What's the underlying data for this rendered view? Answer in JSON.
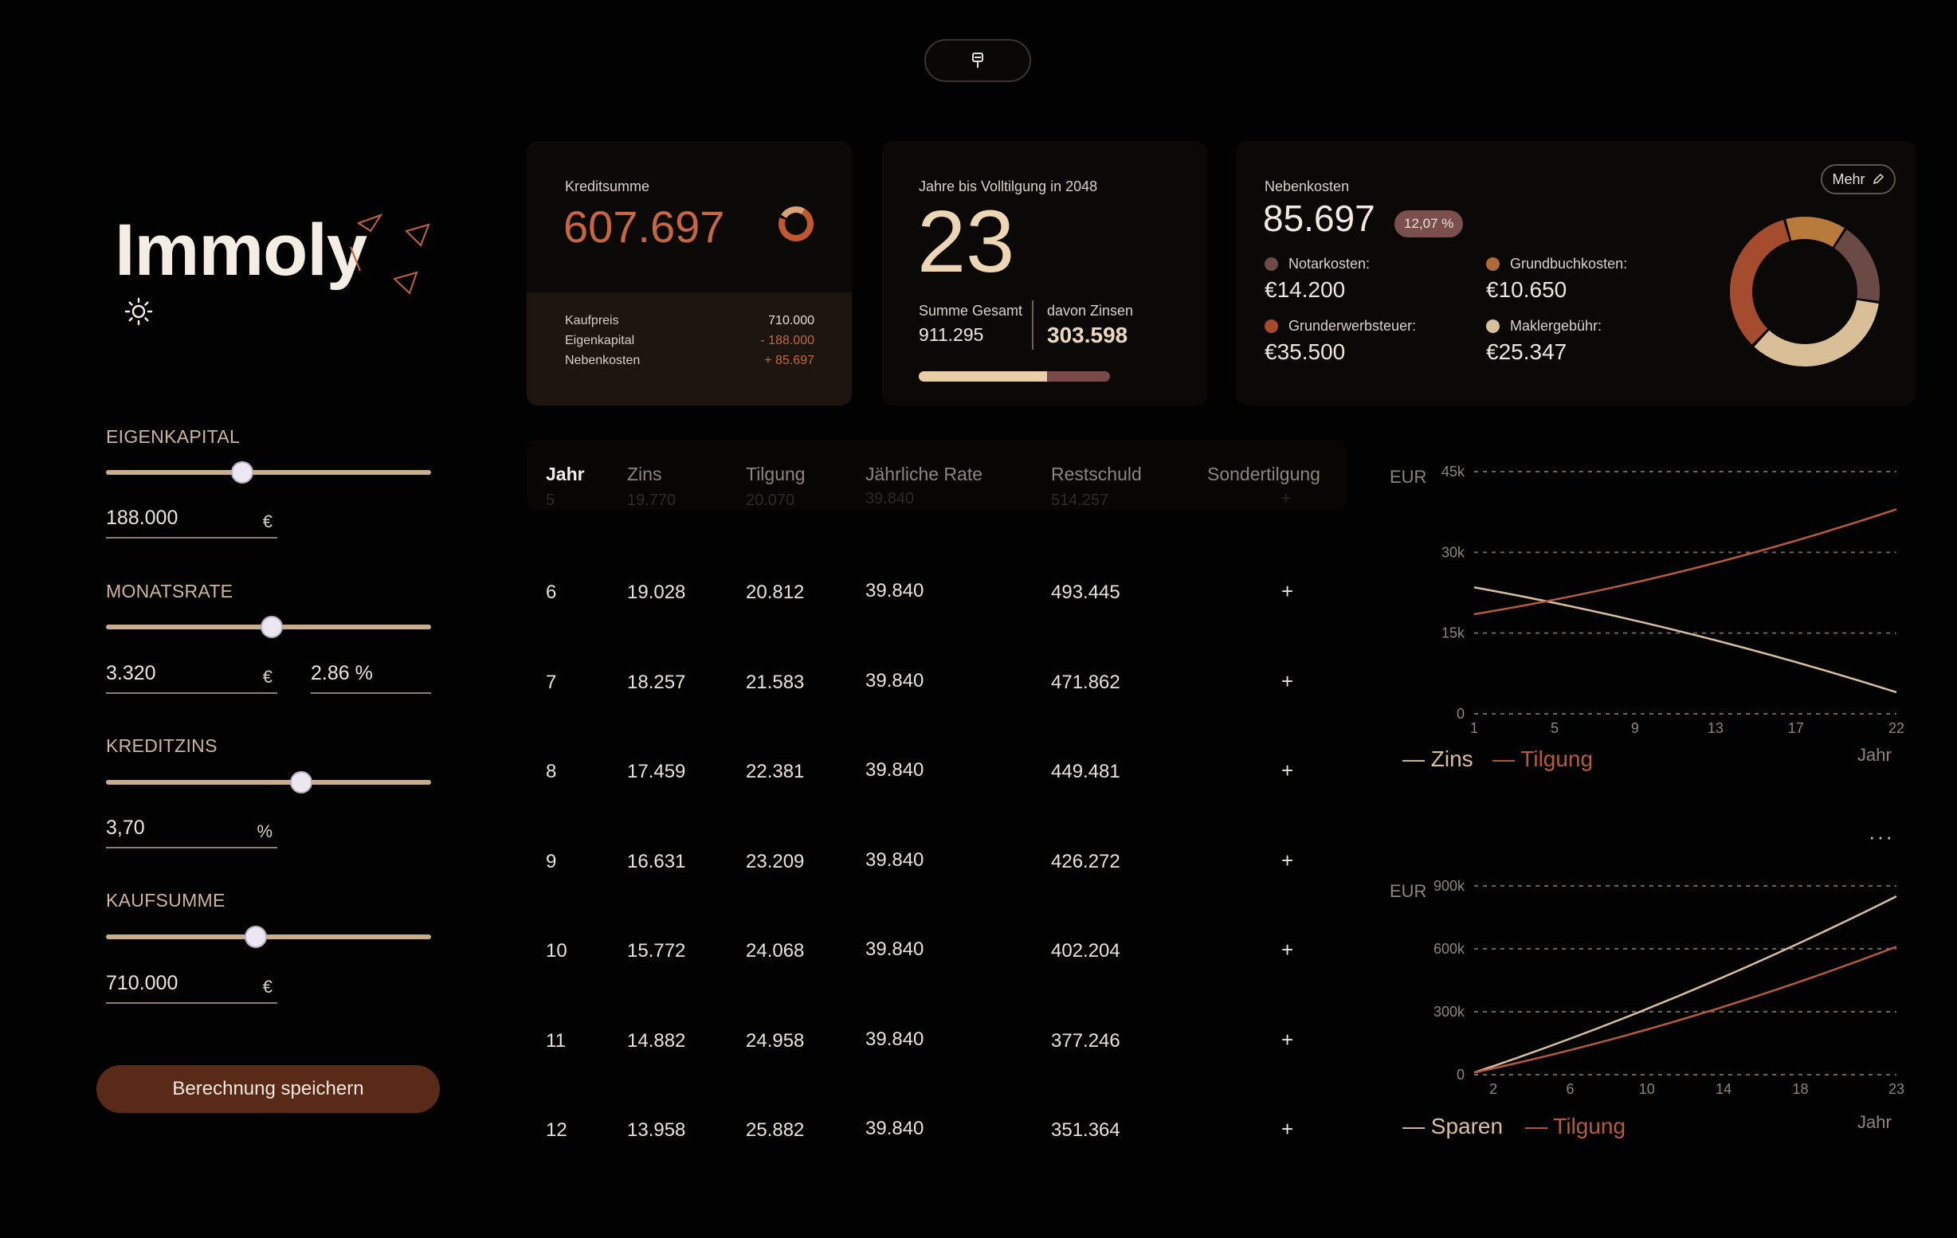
{
  "app": {
    "logo": "Immoly"
  },
  "sidebar": {
    "params": [
      {
        "label": "EIGENKAPITAL",
        "value": "188.000",
        "unit": "€",
        "slider_fraction": 0.42
      },
      {
        "label": "MONATSRATE",
        "value": "3.320",
        "unit": "€",
        "extra_value": "2.86 %",
        "slider_fraction": 0.51
      },
      {
        "label": "KREDITZINS",
        "value": "3,70",
        "unit": "%",
        "slider_fraction": 0.6
      },
      {
        "label": "KAUFSUMME",
        "value": "710.000",
        "unit": "€",
        "slider_fraction": 0.46
      }
    ],
    "save_label": "Berechnung speichern"
  },
  "credit_card": {
    "label": "Kreditsumme",
    "value": "607.697",
    "rows": [
      {
        "label": "Kaufpreis",
        "value": "710.000"
      },
      {
        "label": "Eigenkapital",
        "value": "- 188.000"
      },
      {
        "label": "Nebenkosten",
        "value": "+ 85.697"
      }
    ]
  },
  "years_card": {
    "label": "Jahre bis Volltilgung in 2048",
    "value": "23",
    "total_label": "Summe Gesamt",
    "total_value": "911.295",
    "interest_label": "davon Zinsen",
    "interest_value": "303.598",
    "progress_fraction": 0.67
  },
  "fees_card": {
    "label": "Nebenkosten",
    "value": "85.697",
    "badge": "12,07 %",
    "more_label": "Mehr",
    "items": [
      {
        "label": "Notarkosten:",
        "value": "€14.200",
        "color": "#6e4b45"
      },
      {
        "label": "Grundbuchkosten:",
        "value": "€10.650",
        "color": "#b06a36"
      },
      {
        "label": "Grunderwerbsteuer:",
        "value": "€35.500",
        "color": "#a8492a"
      },
      {
        "label": "Maklergebühr:",
        "value": "€25.347",
        "color": "#d8c09a"
      }
    ]
  },
  "table": {
    "headers": [
      "Jahr",
      "Zins",
      "Tilgung",
      "Jährliche Rate",
      "Restschuld",
      "Sondertilgung"
    ],
    "ghost_row": [
      "5",
      "19.770",
      "20.070",
      "39.840",
      "514.257",
      "+"
    ],
    "rows": [
      [
        "6",
        "19.028",
        "20.812",
        "39.840",
        "493.445",
        "+"
      ],
      [
        "7",
        "18.257",
        "21.583",
        "39.840",
        "471.862",
        "+"
      ],
      [
        "8",
        "17.459",
        "22.381",
        "39.840",
        "449.481",
        "+"
      ],
      [
        "9",
        "16.631",
        "23.209",
        "39.840",
        "426.272",
        "+"
      ],
      [
        "10",
        "15.772",
        "24.068",
        "39.840",
        "402.204",
        "+"
      ],
      [
        "11",
        "14.882",
        "24.958",
        "39.840",
        "377.246",
        "+"
      ],
      [
        "12",
        "13.958",
        "25.882",
        "39.840",
        "351.364",
        "+"
      ]
    ]
  },
  "chart_data": [
    {
      "type": "line",
      "ylabel": "EUR",
      "xlabel": "Jahr",
      "yticks": [
        "0",
        "15k",
        "30k",
        "45k"
      ],
      "xticks": [
        "1",
        "5",
        "9",
        "13",
        "17",
        "22"
      ],
      "ylim": [
        0,
        45000
      ],
      "xlim": [
        1,
        22
      ],
      "grid": true,
      "series": [
        {
          "name": "Zins",
          "color": "#d9bf9c",
          "x": [
            1,
            22
          ],
          "y": [
            23500,
            4000
          ]
        },
        {
          "name": "Tilgung",
          "color": "#b85a3c",
          "x": [
            1,
            22
          ],
          "y": [
            18500,
            38000
          ]
        }
      ]
    },
    {
      "type": "line",
      "ylabel": "EUR",
      "xlabel": "Jahr",
      "yticks": [
        "0",
        "300k",
        "600k",
        "900k"
      ],
      "xticks": [
        "2",
        "6",
        "10",
        "14",
        "18",
        "23"
      ],
      "ylim": [
        0,
        900000
      ],
      "xlim": [
        1,
        23
      ],
      "grid": true,
      "series": [
        {
          "name": "Sparen",
          "color": "#d9bf9c",
          "x": [
            1,
            23
          ],
          "y": [
            10000,
            850000
          ]
        },
        {
          "name": "Tilgung",
          "color": "#b85a3c",
          "x": [
            1,
            23
          ],
          "y": [
            10000,
            610000
          ]
        }
      ]
    }
  ],
  "colors": {
    "accent": "#c86a44",
    "tan": "#d9bf9c",
    "bg": "#030202"
  }
}
